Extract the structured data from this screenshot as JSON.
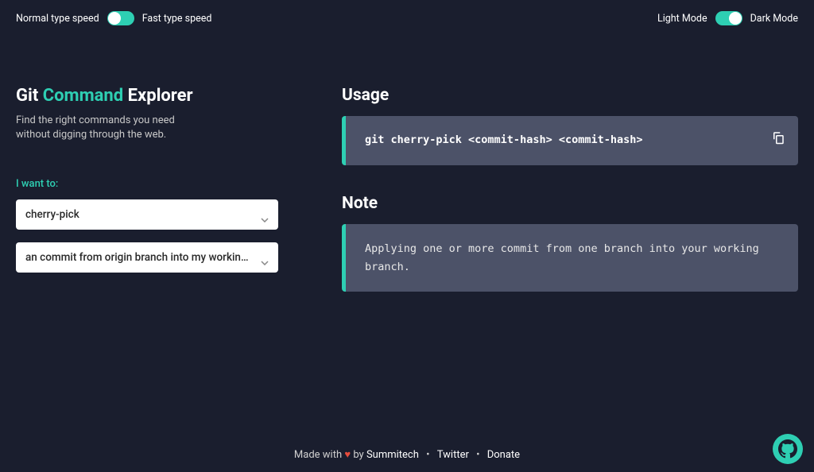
{
  "header": {
    "speed_toggle": {
      "left_label": "Normal type speed",
      "right_label": "Fast type speed"
    },
    "theme_toggle": {
      "left_label": "Light Mode",
      "right_label": "Dark Mode"
    }
  },
  "title": {
    "part1": "Git ",
    "part2": "Command",
    "part3": " Explorer"
  },
  "subtitle_line1": "Find the right commands you need",
  "subtitle_line2": "without digging through the web.",
  "prompt": "I want to:",
  "select1": "cherry-pick",
  "select2": "an commit from origin branch into my workin…",
  "usage": {
    "title": "Usage",
    "code": "git cherry-pick <commit-hash> <commit-hash>"
  },
  "note": {
    "title": "Note",
    "text": "Applying one or more commit from one branch into your working branch."
  },
  "footer": {
    "made_with": "Made with ",
    "by": " by ",
    "author": "Summitech",
    "link1": "Twitter",
    "link2": "Donate"
  }
}
